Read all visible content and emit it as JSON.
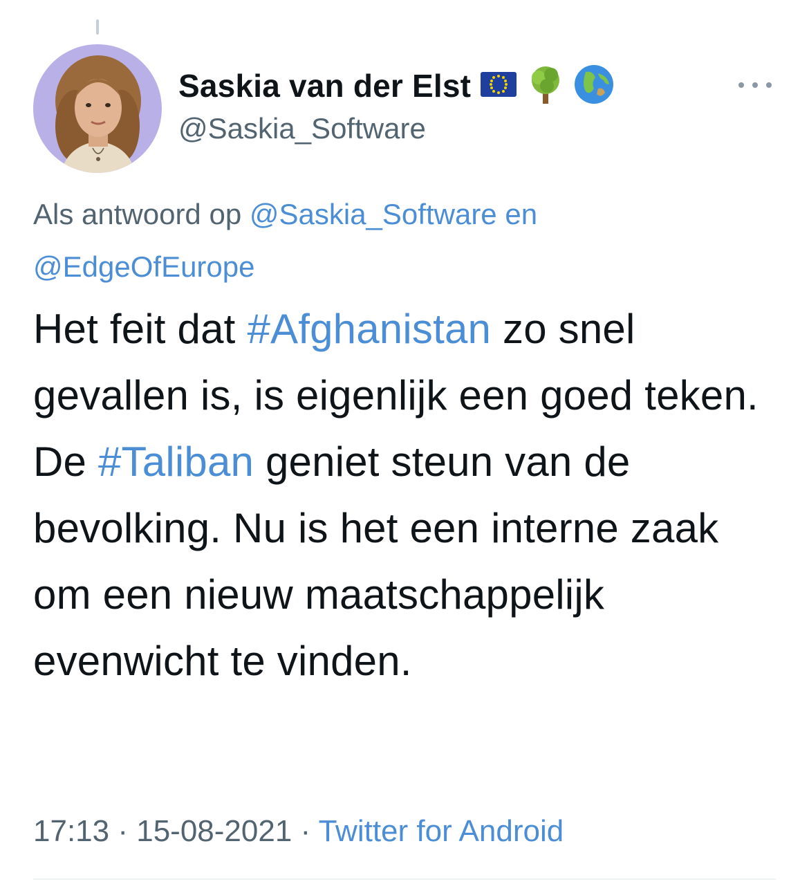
{
  "tweet": {
    "author": {
      "display_name": "Saskia van der Elst",
      "handle": "@Saskia_Software",
      "name_emojis": [
        "🇪🇺",
        "🌳",
        "🌍"
      ]
    },
    "reply_context": {
      "prefix": "Als antwoord op ",
      "mention_1": "@Saskia_Software",
      "connector": " en",
      "mention_2": "@EdgeOfEurope"
    },
    "text": {
      "part_1": "Het feit dat ",
      "hashtag_1": "#Afghanistan",
      "part_2": " zo snel gevallen is, is eigenlijk een goed teken. De ",
      "hashtag_2": "#Taliban",
      "part_3": " geniet steun van de bevolking. Nu is het een interne zaak om een nieuw maatschappelijk evenwicht te vinden."
    },
    "meta": {
      "time": "17:13",
      "separator": " · ",
      "date": "15-08-2021",
      "source": "Twitter for Android"
    }
  },
  "icons": {
    "more": "more-horizontal-icon",
    "eu_flag": "eu-flag-icon",
    "tree": "tree-icon",
    "globe": "globe-icon"
  },
  "colors": {
    "link": "#4b8ed6",
    "secondary_text": "#536471",
    "primary_text": "#0f1419"
  }
}
